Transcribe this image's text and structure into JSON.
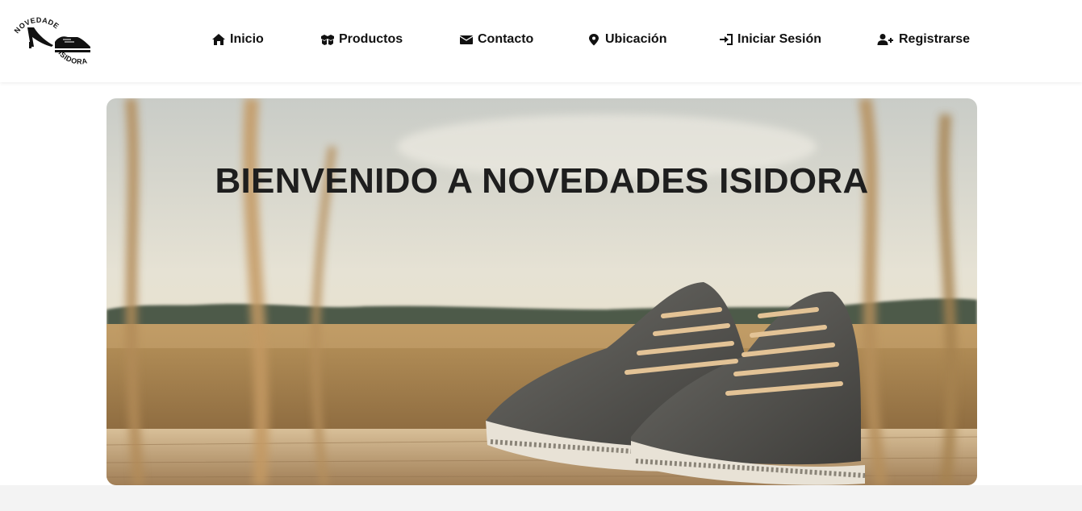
{
  "brand": {
    "logo_top_text": "NOVEDADES",
    "logo_bottom_text": "ISIDORA"
  },
  "nav": {
    "items": [
      {
        "label": "Inicio",
        "icon": "home-icon"
      },
      {
        "label": "Productos",
        "icon": "boxes-icon"
      },
      {
        "label": "Contacto",
        "icon": "envelope-icon"
      },
      {
        "label": "Ubicación",
        "icon": "map-marker-icon"
      },
      {
        "label": "Iniciar Sesión",
        "icon": "sign-in-icon"
      },
      {
        "label": "Registrarse",
        "icon": "user-plus-icon"
      }
    ]
  },
  "hero": {
    "title": "BIENVENIDO A NOVEDADES ISIDORA",
    "image": "sneakers-in-wheat-field"
  },
  "colors": {
    "text": "#111111",
    "navbar_bg": "#ffffff",
    "page_bg": "#f3f3f3"
  }
}
